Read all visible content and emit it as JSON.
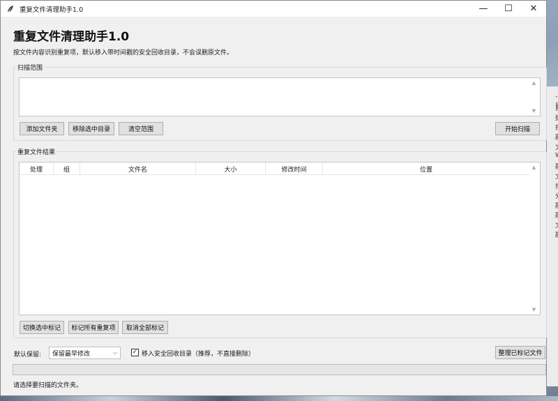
{
  "window": {
    "title": "重复文件清理助手1.0",
    "controls": {
      "minimize": "—",
      "maximize": "☐",
      "close": "✕"
    },
    "app_icon": "feather-icon"
  },
  "header": {
    "title": "重复文件清理助手1.0",
    "subtitle": "按文件内容识别重复项，默认移入带时间戳的安全回收目录，不会误删原文件。"
  },
  "scan_scope": {
    "label": "扫描范围",
    "buttons": {
      "add": "添加文件夹",
      "remove": "移除选中目录",
      "clear": "清空范围",
      "start": "开始扫描"
    }
  },
  "results": {
    "label": "重复文件结果",
    "columns": [
      "处理",
      "组",
      "文件名",
      "大小",
      "修改时间",
      "位置"
    ],
    "rows": [],
    "buttons": {
      "toggle": "切换选中标记",
      "mark_all": "标记所有重复项",
      "unmark_all": "取消全部标记"
    }
  },
  "options": {
    "keep_label": "默认保留:",
    "keep_value": "保留最早修改",
    "move_to_recycle_label": "移入安全回收目录（推荐，不直接删除）",
    "move_to_recycle_checked": true,
    "organize_button": "整理已标记文件"
  },
  "progress": {
    "value": 0
  },
  "status": "请选择要扫描的文件夹。",
  "desktop_edge": [
    "-目",
    "目",
    "捷",
    "扫",
    "融",
    "文",
    "W",
    "融",
    "文",
    "扫",
    "分",
    "融",
    "融",
    "文",
    "融"
  ]
}
